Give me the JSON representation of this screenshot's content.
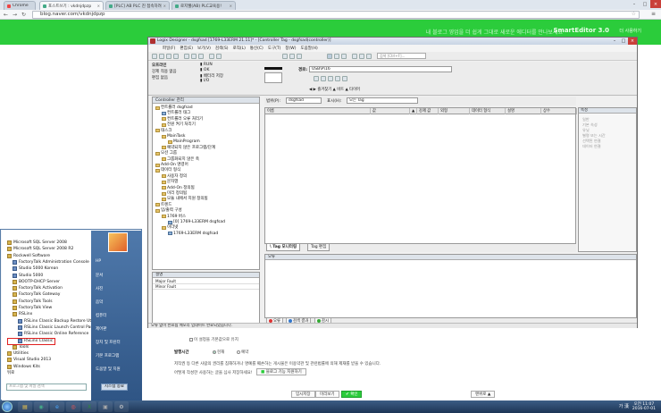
{
  "browser": {
    "tabs": [
      {
        "label": "Chrome",
        "active": false
      },
      {
        "label": "포스트쓰기 : vkdnjdpzp",
        "active": true
      },
      {
        "label": "[PLC] AB PLC 진 접속하려",
        "active": false
      },
      {
        "label": "로지웰(AB) PLC교육용!",
        "active": false
      }
    ],
    "address": "blog.naver.com/vkdnjdpzp",
    "back_icon": "back-arrow-icon",
    "forward_icon": "forward-arrow-icon",
    "reload_icon": "reload-icon"
  },
  "blog": {
    "banner_text": "내 블로그 영업을 더 쉽게 그대로 새로운 에디터를 만나보세요",
    "smart_editor": "SmartEditor",
    "smart_version": "3.0",
    "smart_cta": "더 사용하기",
    "checkbox_label": "이 설정을 기본값으로 유지",
    "publish_time_label": "발행시간",
    "radio_now": "현재",
    "radio_reserve": "예약",
    "notice_line1": "저작권 등 다른 사람의 권리를 침해하거나 명예를 훼손하는 게시물은 이용약관 및 관련법률에 의해 제재를 받을 수 있습니다.",
    "notice_line2": "어떻게 작성한 사용하는 글을 심사 저장하세요!",
    "reserve_btn": "블로그 기능 지원하기",
    "btn_temp_save": "임시저장",
    "btn_preview": "미리보기",
    "btn_publish": "✔ 확인",
    "btn_top": "맨위로 ▲"
  },
  "logix": {
    "title": "Logix Designer - dsgfsad [1769-L33ERM 21.11]* - [Controller Tag - dsgfsad(controller)]",
    "menu": [
      "파일(F)",
      "편집(E)",
      "보기(V)",
      "검색(S)",
      "로직(L)",
      "통신(C)",
      "도구(T)",
      "창(W)",
      "도움말(H)"
    ],
    "search_placeholder": "검색 [Ctrl+F]...",
    "status": {
      "offline": "오프라인",
      "forces": "강제 적용 없음",
      "edits": "편집 없음",
      "run": "RUN",
      "ok": "OK",
      "bat": "배터리 저장",
      "io": "I/O"
    },
    "path_label": "경로:",
    "path_value": "USB\\P\\16",
    "instruction_tabs": "◀ ▶ 즐겨찾기 ▲ 비트 ▲ 타이머",
    "organizer": {
      "title": "Controller 관리",
      "items": [
        {
          "label": "컨트롤러 dsgfsad",
          "level": 0,
          "folder": true
        },
        {
          "label": "컨트롤러 태그",
          "level": 1,
          "folder": false
        },
        {
          "label": "컨트롤러 오류 처리기",
          "level": 1,
          "folder": true
        },
        {
          "label": "전원 켜기 처리기",
          "level": 1,
          "folder": true
        },
        {
          "label": "태스크",
          "level": 0,
          "folder": true
        },
        {
          "label": "MainTask",
          "level": 1,
          "folder": true
        },
        {
          "label": "MainProgram",
          "level": 2,
          "folder": true
        },
        {
          "label": "예약되지 않은 프로그램/단계",
          "level": 1,
          "folder": true
        },
        {
          "label": "모션 그룹",
          "level": 0,
          "folder": true
        },
        {
          "label": "그룹화되지 않은 축",
          "level": 1,
          "folder": true
        },
        {
          "label": "Add-On 명령어",
          "level": 0,
          "folder": true
        },
        {
          "label": "데이터 형식",
          "level": 0,
          "folder": true
        },
        {
          "label": "사용자 정의",
          "level": 1,
          "folder": true
        },
        {
          "label": "문자열",
          "level": 1,
          "folder": true
        },
        {
          "label": "Add-On 정의됨",
          "level": 1,
          "folder": true
        },
        {
          "label": "미리 정의됨",
          "level": 1,
          "folder": true
        },
        {
          "label": "모듈 내에서 지원 정의됨",
          "level": 1,
          "folder": true
        },
        {
          "label": "트렌드",
          "level": 0,
          "folder": true
        },
        {
          "label": "입/출력 구성",
          "level": 0,
          "folder": true
        },
        {
          "label": "1769 버스",
          "level": 1,
          "folder": true
        },
        {
          "label": "[0] 1769-L33ERM dsgfsad",
          "level": 2,
          "folder": false
        },
        {
          "label": "이더넷",
          "level": 1,
          "folder": true
        },
        {
          "label": "1769-L33ERM dsgfsad",
          "level": 2,
          "folder": false
        }
      ]
    },
    "properties_pane": {
      "title": "설명",
      "rows": [
        "Major Fault",
        "Minor Fault"
      ]
    },
    "scope_label": "범위(P):",
    "scope_value": "dsgfsad",
    "show_label": "표시(H):",
    "show_value": "모든 Tag",
    "tag_columns": [
      "이름",
      "값",
      "▲",
      "강제 값",
      "외형",
      "데이터 형식",
      "설명",
      "상수"
    ],
    "tag_tabs": [
      "\\ Tag 모니터링",
      "Tag 편집"
    ],
    "right_pane": {
      "title": "속성",
      "items": [
        "일반",
        "기본 속성",
        "유닛",
        "별명 또는 시간",
        "선택된 연결",
        "데이터 연결"
      ]
    },
    "output_title": "오류",
    "output_tabs": [
      "오류",
      "검색 결과",
      "감시"
    ],
    "statusbar": "오류 없이 완료됨 메모리 업데이트 완료되었습니다."
  },
  "start_menu": {
    "programs": [
      {
        "label": "Microsoft SQL Server 2008",
        "level": 0,
        "type": "folder"
      },
      {
        "label": "Microsoft SQL Server 2008 R2",
        "level": 0,
        "type": "folder"
      },
      {
        "label": "Rockwell Software",
        "level": 0,
        "type": "folder"
      },
      {
        "label": "FactoryTalk Administration Console",
        "level": 1,
        "type": "app"
      },
      {
        "label": "Studio 5000 Korean",
        "level": 1,
        "type": "app"
      },
      {
        "label": "Studio 5000",
        "level": 1,
        "type": "app"
      },
      {
        "label": "BOOTP-DHCP Server",
        "level": 1,
        "type": "folder"
      },
      {
        "label": "FactoryTalk Activation",
        "level": 1,
        "type": "folder"
      },
      {
        "label": "FactoryTalk Gateway",
        "level": 1,
        "type": "folder"
      },
      {
        "label": "FactoryTalk Tools",
        "level": 1,
        "type": "folder"
      },
      {
        "label": "FactoryTalk View",
        "level": 1,
        "type": "folder"
      },
      {
        "label": "RSLinx",
        "level": 1,
        "type": "folder"
      },
      {
        "label": "RSLinx Classic Backup Restore Utility",
        "level": 2,
        "type": "app"
      },
      {
        "label": "RSLinx Classic Launch Control Panel",
        "level": 2,
        "type": "app"
      },
      {
        "label": "RSLinx Classic Online Reference",
        "level": 2,
        "type": "app"
      },
      {
        "label": "RSLinx Classic",
        "level": 2,
        "type": "app"
      },
      {
        "label": "Tools",
        "level": 1,
        "type": "folder"
      },
      {
        "label": "Utilities",
        "level": 0,
        "type": "folder"
      },
      {
        "label": "Visual Studio 2013",
        "level": 0,
        "type": "folder"
      },
      {
        "label": "Windows Kits",
        "level": 0,
        "type": "folder"
      },
      {
        "label": "뒤로",
        "level": 0,
        "type": "back"
      }
    ],
    "right_items": [
      "HP",
      "문서",
      "사진",
      "음악",
      "컴퓨터",
      "제어판",
      "장치 및 프린터",
      "기본 프로그램",
      "도움말 및 지원"
    ],
    "search_placeholder": "프로그램 및 파일 검색",
    "shutdown": "시스템 종료"
  },
  "taskbar": {
    "apps": [
      "folder-icon",
      "media-icon",
      "ie-icon",
      "chrome-icon",
      "excel-icon",
      "app-icon",
      "tools-icon"
    ],
    "ime": "가 漢 ",
    "time": "오전 11:07",
    "date": "2016-07-01"
  },
  "colors": {
    "naver_green": "#2bcc3b",
    "start_menu_blue": "#4f79ab",
    "highlight_red": "#e02020"
  }
}
